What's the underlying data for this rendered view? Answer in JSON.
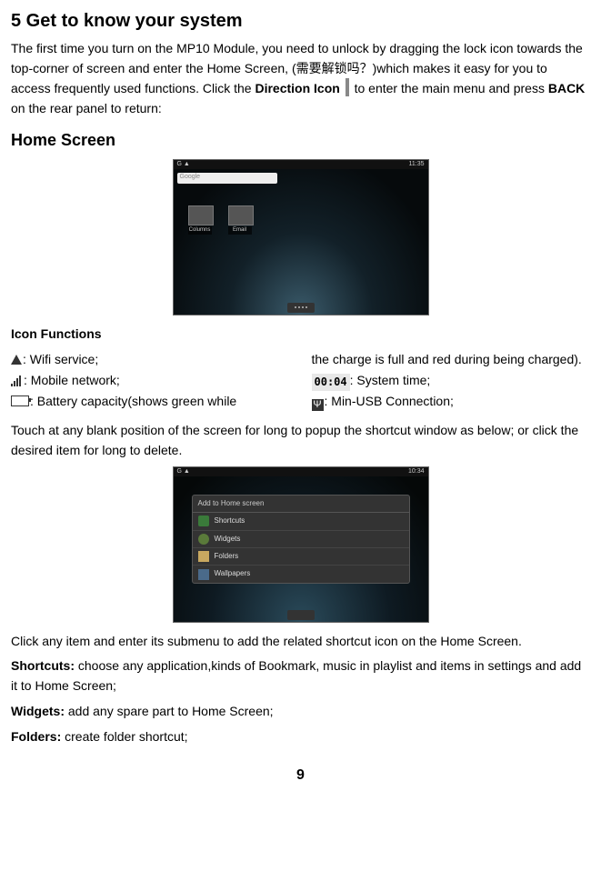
{
  "heading": "5 Get to know your system",
  "intro_a": "The first time you turn on the MP10 Module, you need to unlock by dragging the lock icon towards the top-corner of screen and enter the Home Screen, (",
  "intro_zh": "需要解锁吗？",
  "intro_b": ")which makes it easy for you to access frequently used functions. Click the ",
  "dir_label": "Direction Icon",
  "intro_c": " to enter the main menu and press ",
  "back_label": "BACK",
  "intro_d": " on the rear panel to return:",
  "home_screen_h": "Home Screen",
  "shot1": {
    "time": "11:35",
    "icons": "G ▲",
    "google": "Google",
    "app1": "Columns",
    "app2": "Email"
  },
  "iconfns_h": "Icon Functions",
  "left": {
    "wifi": ": Wifi service;",
    "mob": ": Mobile network;",
    "batt": ": Battery capacity(shows green while"
  },
  "right": {
    "charge": "the charge is full and red during being charged).",
    "clock_val": "00:04",
    "clock": ": System time;",
    "usb": ": Min-USB Connection;"
  },
  "para2": "Touch at any blank position of the screen for long to popup the shortcut window as below; or click the desired item for long to delete.",
  "shot2": {
    "time": "10:34",
    "icons": "G ▲",
    "title": "Add to Home screen",
    "rows": [
      "Shortcuts",
      "Widgets",
      "Folders",
      "Wallpapers"
    ]
  },
  "para3": "Click any item and enter its submenu to add the related shortcut icon on the Home Screen.",
  "sc_h": "Shortcuts:",
  "sc_t": " choose any application,kinds of Bookmark, music in playlist and items in settings and add it to Home Screen;",
  "wg_h": "Widgets:",
  "wg_t": " add any spare part to Home Screen;",
  "fd_h": "Folders:",
  "fd_t": " create folder shortcut;",
  "page": "9"
}
